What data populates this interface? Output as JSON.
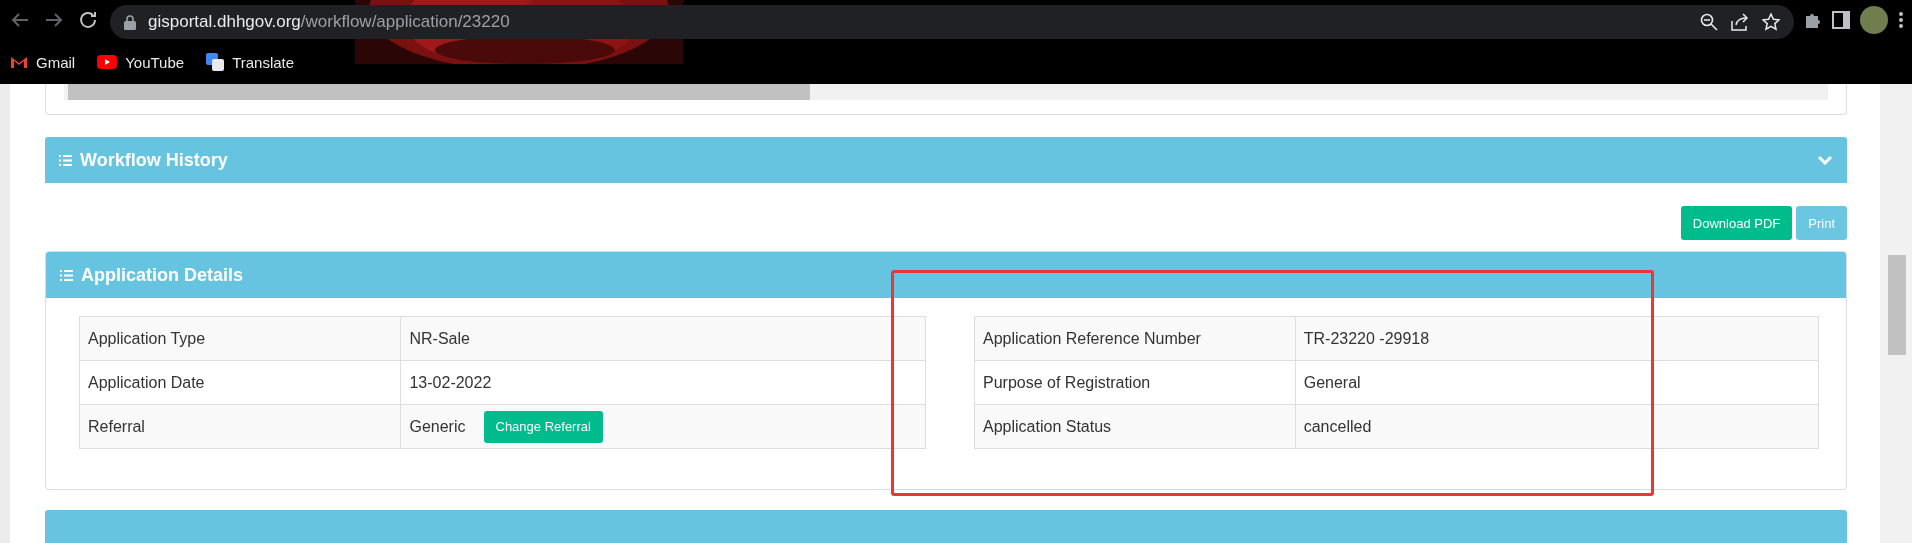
{
  "browser": {
    "url_host": "gisportal.dhhgov.org",
    "url_path": "/workflow/application/23220",
    "bookmarks": [
      {
        "label": "Gmail",
        "kind": "gmail"
      },
      {
        "label": "YouTube",
        "kind": "youtube"
      },
      {
        "label": "Translate",
        "kind": "translate"
      }
    ]
  },
  "workflow_history": {
    "title": "Workflow History",
    "expanded": false
  },
  "actions": [
    {
      "label": "Download PDF",
      "kind": "success"
    },
    {
      "label": "Print",
      "kind": "info"
    }
  ],
  "application_details": {
    "title": "Application Details",
    "left_rows": [
      {
        "label": "Application Type",
        "value": "NR-Sale"
      },
      {
        "label": "Application Date",
        "value": "13-02-2022"
      },
      {
        "label": "Referral",
        "value": "Generic",
        "button": "Change Referral"
      }
    ],
    "right_rows": [
      {
        "label": "Application Reference Number",
        "value": "TR-23220 -29918"
      },
      {
        "label": "Purpose of Registration",
        "value": "General"
      },
      {
        "label": "Application Status",
        "value": "cancelled"
      }
    ]
  }
}
